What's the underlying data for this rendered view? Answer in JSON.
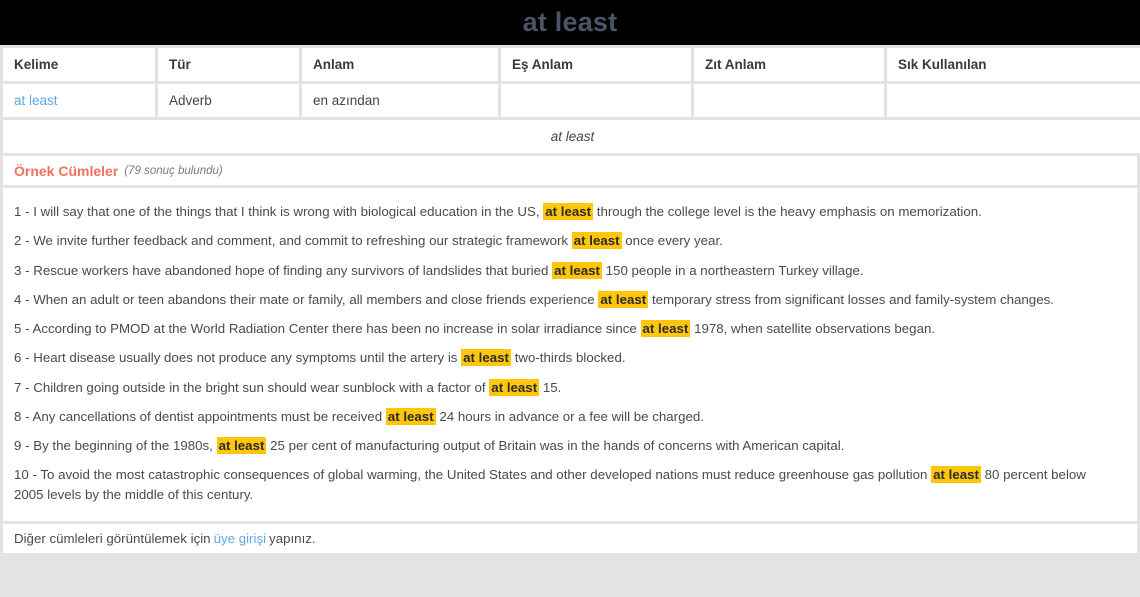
{
  "header": {
    "title": "at least"
  },
  "word_table": {
    "columns": [
      "Kelime",
      "Tür",
      "Anlam",
      "Eş Anlam",
      "Zıt Anlam",
      "Sık Kullanılan"
    ],
    "row": {
      "kelime": "at least",
      "tur": "Adverb",
      "anlam": "en azından",
      "es_anlam": "",
      "zit_anlam": "",
      "sik_kullanilan": ""
    },
    "phrase_row": "at least"
  },
  "examples": {
    "heading": "Örnek Cümleler",
    "count_label": "(79 sonuç bulundu)",
    "highlight_term": "at least",
    "highlight_color": "#ffc60b",
    "items": [
      {
        "number": "1 - ",
        "before": "I will say that one of the things that I think is wrong with biological education in the US,",
        "highlight": "at least",
        "after": "through the college level is the heavy emphasis on memorization."
      },
      {
        "number": "2 - ",
        "before": "We invite further feedback and comment, and commit to refreshing our strategic framework",
        "highlight": "at least",
        "after": "once every year."
      },
      {
        "number": "3 - ",
        "before": "Rescue workers have abandoned hope of finding any survivors of landslides that buried",
        "highlight": "at least",
        "after": "150 people in a northeastern Turkey village."
      },
      {
        "number": "4 - ",
        "before": "When an adult or teen abandons their mate or family, all members and close friends experience",
        "highlight": "at least",
        "after": "temporary stress from significant losses and family-system changes."
      },
      {
        "number": "5 - ",
        "before": "According to PMOD at the World Radiation Center there has been no increase in solar irradiance since",
        "highlight": "at least",
        "after": "1978, when satellite observations began."
      },
      {
        "number": "6 - ",
        "before": "Heart disease usually does not produce any symptoms until the artery is",
        "highlight": "at least",
        "after": "two-thirds blocked."
      },
      {
        "number": "7 - ",
        "before": "Children going outside in the bright sun should wear sunblock with a factor of",
        "highlight": "at least",
        "after": "15."
      },
      {
        "number": "8 - ",
        "before": "Any cancellations of dentist appointments must be received",
        "highlight": "at least",
        "after": "24 hours in advance or a fee will be charged."
      },
      {
        "number": "9 - ",
        "before": "By the beginning of the 1980s,",
        "highlight": "at least",
        "after": "25 per cent of manufacturing output of Britain was in the hands of concerns with American capital."
      },
      {
        "number": "10 - ",
        "before": "To avoid the most catastrophic consequences of global warming, the United States and other developed nations must reduce greenhouse gas pollution",
        "highlight": "at least",
        "after": "80 percent below 2005 levels by the middle of this century."
      }
    ]
  },
  "login_note": {
    "before": "Diğer cümleleri görüntülemek için",
    "link": "üye girişi",
    "after": "yapınız."
  },
  "colors": {
    "banner_bg": "#000000",
    "title_text": "#4b5468",
    "link_blue": "#5ba9e8",
    "heading_red": "#f4705f",
    "highlight_yellow": "#ffc60b",
    "page_bg": "#e3e3e3"
  }
}
